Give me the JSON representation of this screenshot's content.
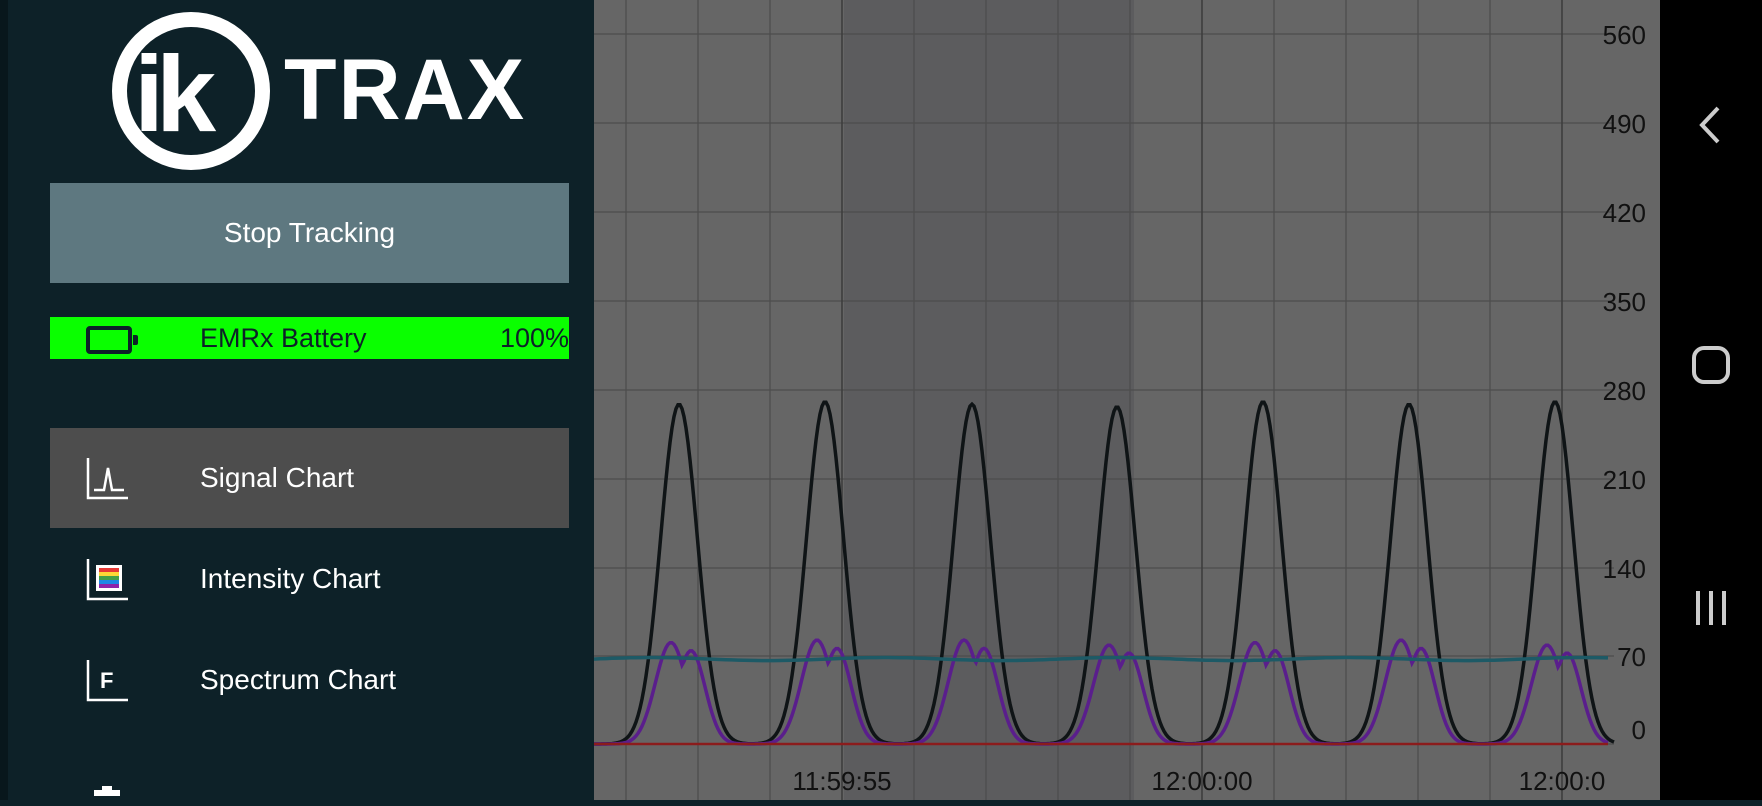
{
  "logo": {
    "mark": "ik",
    "brand": "TRAX"
  },
  "sidebar": {
    "stop_label": "Stop Tracking",
    "battery": {
      "label": "EMRx Battery",
      "percent": "100%",
      "level": 1.0,
      "color": "#0aff00"
    },
    "nav": [
      {
        "label": "Signal Chart",
        "icon": "signal-chart-icon",
        "active": true
      },
      {
        "label": "Intensity Chart",
        "icon": "intensity-chart-icon",
        "active": false
      },
      {
        "label": "Spectrum Chart",
        "icon": "spectrum-chart-icon",
        "active": false
      }
    ],
    "spectrum_icon_letter": "F"
  },
  "chart_data": {
    "type": "line",
    "y_ticks": [
      "560",
      "490",
      "420",
      "350",
      "280",
      "210",
      "140",
      "70",
      "0"
    ],
    "ylim": [
      0,
      560
    ],
    "x_ticks": [
      "11:59:55",
      "12:00:00",
      "12:00:0"
    ],
    "grid": true,
    "series": [
      {
        "color": "#0f1416",
        "peaks": [
          268,
          270,
          268,
          266,
          270,
          268,
          270
        ],
        "base": 0
      },
      {
        "color": "#5a1e8c",
        "peaks": [
          80,
          82,
          82,
          78,
          80,
          82,
          78
        ],
        "base": 0
      },
      {
        "color": "#1d5a66",
        "values_level": 67
      },
      {
        "color": "#8b1c1c",
        "values_level": 0
      }
    ]
  },
  "android_nav": {
    "back": "back-icon",
    "home": "home-icon",
    "recents": "recents-icon"
  }
}
